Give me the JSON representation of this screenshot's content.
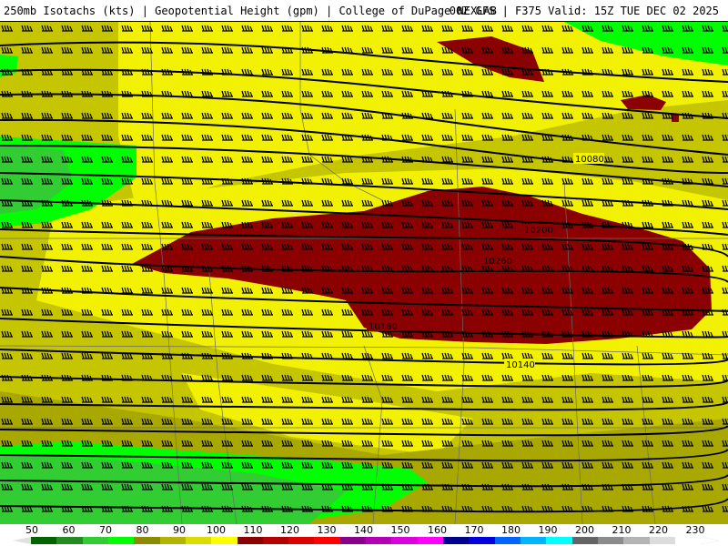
{
  "header": {
    "title_left": "250mb Isotachs (kts) | Geopotential Height (gpm) | College of DuPage NEXLAB",
    "title_right": "00Z GFS | F375 Valid: 15Z TUE DEC 02 2025"
  },
  "map": {
    "height_labels": [
      "10080",
      "10200",
      "10260",
      "10180",
      "10140"
    ],
    "wind_barb_icon": "wind-barb-icon"
  },
  "colorbar": {
    "ticks": [
      "50",
      "60",
      "70",
      "80",
      "90",
      "100",
      "110",
      "120",
      "130",
      "140",
      "150",
      "160",
      "170",
      "180",
      "190",
      "200",
      "210",
      "220",
      "230"
    ],
    "colors": [
      "#006400",
      "#228b22",
      "#32cd32",
      "#00ff00",
      "#8b8b00",
      "#b4b400",
      "#dcdc00",
      "#ffff00",
      "#8b0000",
      "#b40000",
      "#dc0000",
      "#ff0000",
      "#8b008b",
      "#b400b4",
      "#dc00dc",
      "#ff00ff",
      "#00008b",
      "#0000dc",
      "#0064ff",
      "#00b4ff",
      "#00ffff",
      "#646464",
      "#8c8c8c",
      "#b4b4b4",
      "#dcdcdc",
      "#ffffff"
    ]
  }
}
